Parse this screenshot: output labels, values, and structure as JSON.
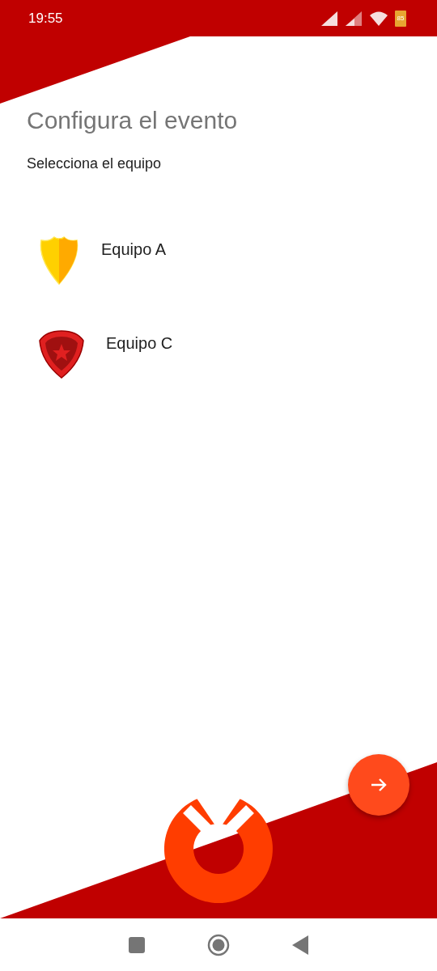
{
  "status_bar": {
    "time": "19:55",
    "battery": "85"
  },
  "title": "Configura el evento",
  "subtitle": "Selecciona el equipo",
  "teams": [
    {
      "name": "Equipo A",
      "kind": "shield"
    },
    {
      "name": "Equipo C",
      "kind": "badge"
    }
  ]
}
